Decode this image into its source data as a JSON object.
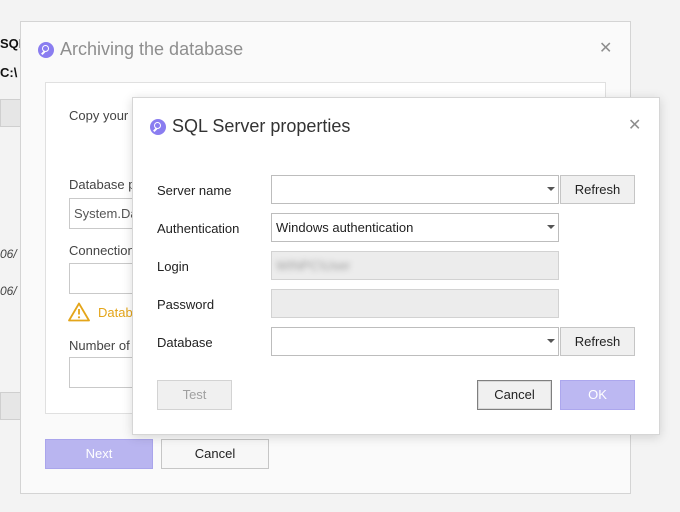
{
  "background_app": {
    "fragment_1": "SQL",
    "fragment_2": "C:\\",
    "fragment_3": "06/",
    "fragment_4": "06/"
  },
  "outer_dialog": {
    "title": "Archiving the database",
    "copy_text": "Copy your",
    "database_label": "Database p",
    "database_value": "System.Da",
    "connection_label": "Connection",
    "warning_text": "Datab",
    "number_label": "Number of",
    "next_label": "Next",
    "cancel_label": "Cancel"
  },
  "inner_dialog": {
    "title": "SQL Server properties",
    "server_name_label": "Server name",
    "server_name_value": "",
    "refresh_label_1": "Refresh",
    "authentication_label": "Authentication",
    "authentication_value": "Windows authentication",
    "login_label": "Login",
    "login_value": "WINPC\\User",
    "password_label": "Password",
    "database_label": "Database",
    "database_value": "",
    "refresh_label_2": "Refresh",
    "test_label": "Test",
    "cancel_label": "Cancel",
    "ok_label": "OK"
  },
  "colors": {
    "accent": "#8a7df0",
    "primary_disabled": "#bcb8f2",
    "warning": "#e4a51a"
  },
  "icons": {
    "app_logo": "app-logo-icon",
    "close": "close-icon",
    "warning": "warning-icon",
    "dropdown": "chevron-down-icon"
  }
}
